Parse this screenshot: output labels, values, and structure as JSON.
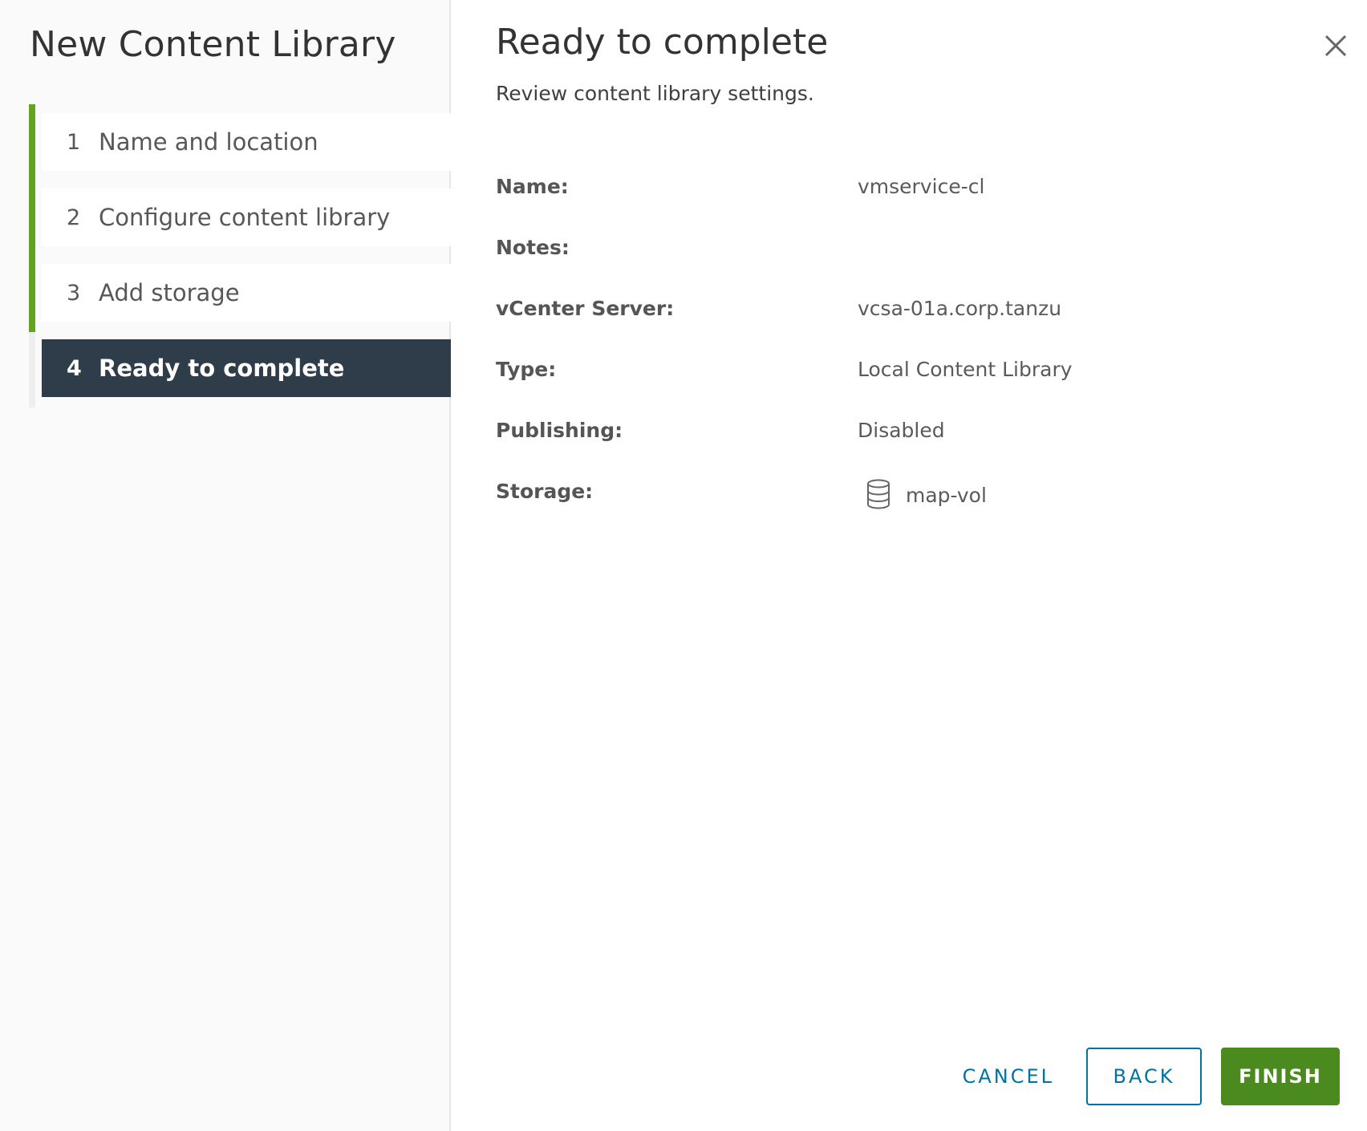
{
  "wizard": {
    "title": "New Content Library",
    "progress_completed_steps": 3,
    "progress_total_steps": 4,
    "progress_color": "#62a420",
    "steps": [
      {
        "number": "1",
        "label": "Name and location",
        "state": "completed"
      },
      {
        "number": "2",
        "label": "Configure content library",
        "state": "completed"
      },
      {
        "number": "3",
        "label": "Add storage",
        "state": "completed"
      },
      {
        "number": "4",
        "label": "Ready to complete",
        "state": "active"
      }
    ]
  },
  "page": {
    "title": "Ready to complete",
    "subtitle": "Review content library settings.",
    "close_icon": "close-icon"
  },
  "review": {
    "rows": [
      {
        "label": "Name:",
        "value": "vmservice-cl"
      },
      {
        "label": "Notes:",
        "value": ""
      },
      {
        "label": "vCenter Server:",
        "value": "vcsa-01a.corp.tanzu"
      },
      {
        "label": "Type:",
        "value": "Local Content Library"
      },
      {
        "label": "Publishing:",
        "value": "Disabled"
      },
      {
        "label": "Storage:",
        "value": "map-vol",
        "icon": "datastore-icon"
      }
    ]
  },
  "footer": {
    "cancel_label": "CANCEL",
    "back_label": "BACK",
    "finish_label": "FINISH",
    "accent_color": "#0072a3",
    "finish_color": "#4b8a1f"
  }
}
